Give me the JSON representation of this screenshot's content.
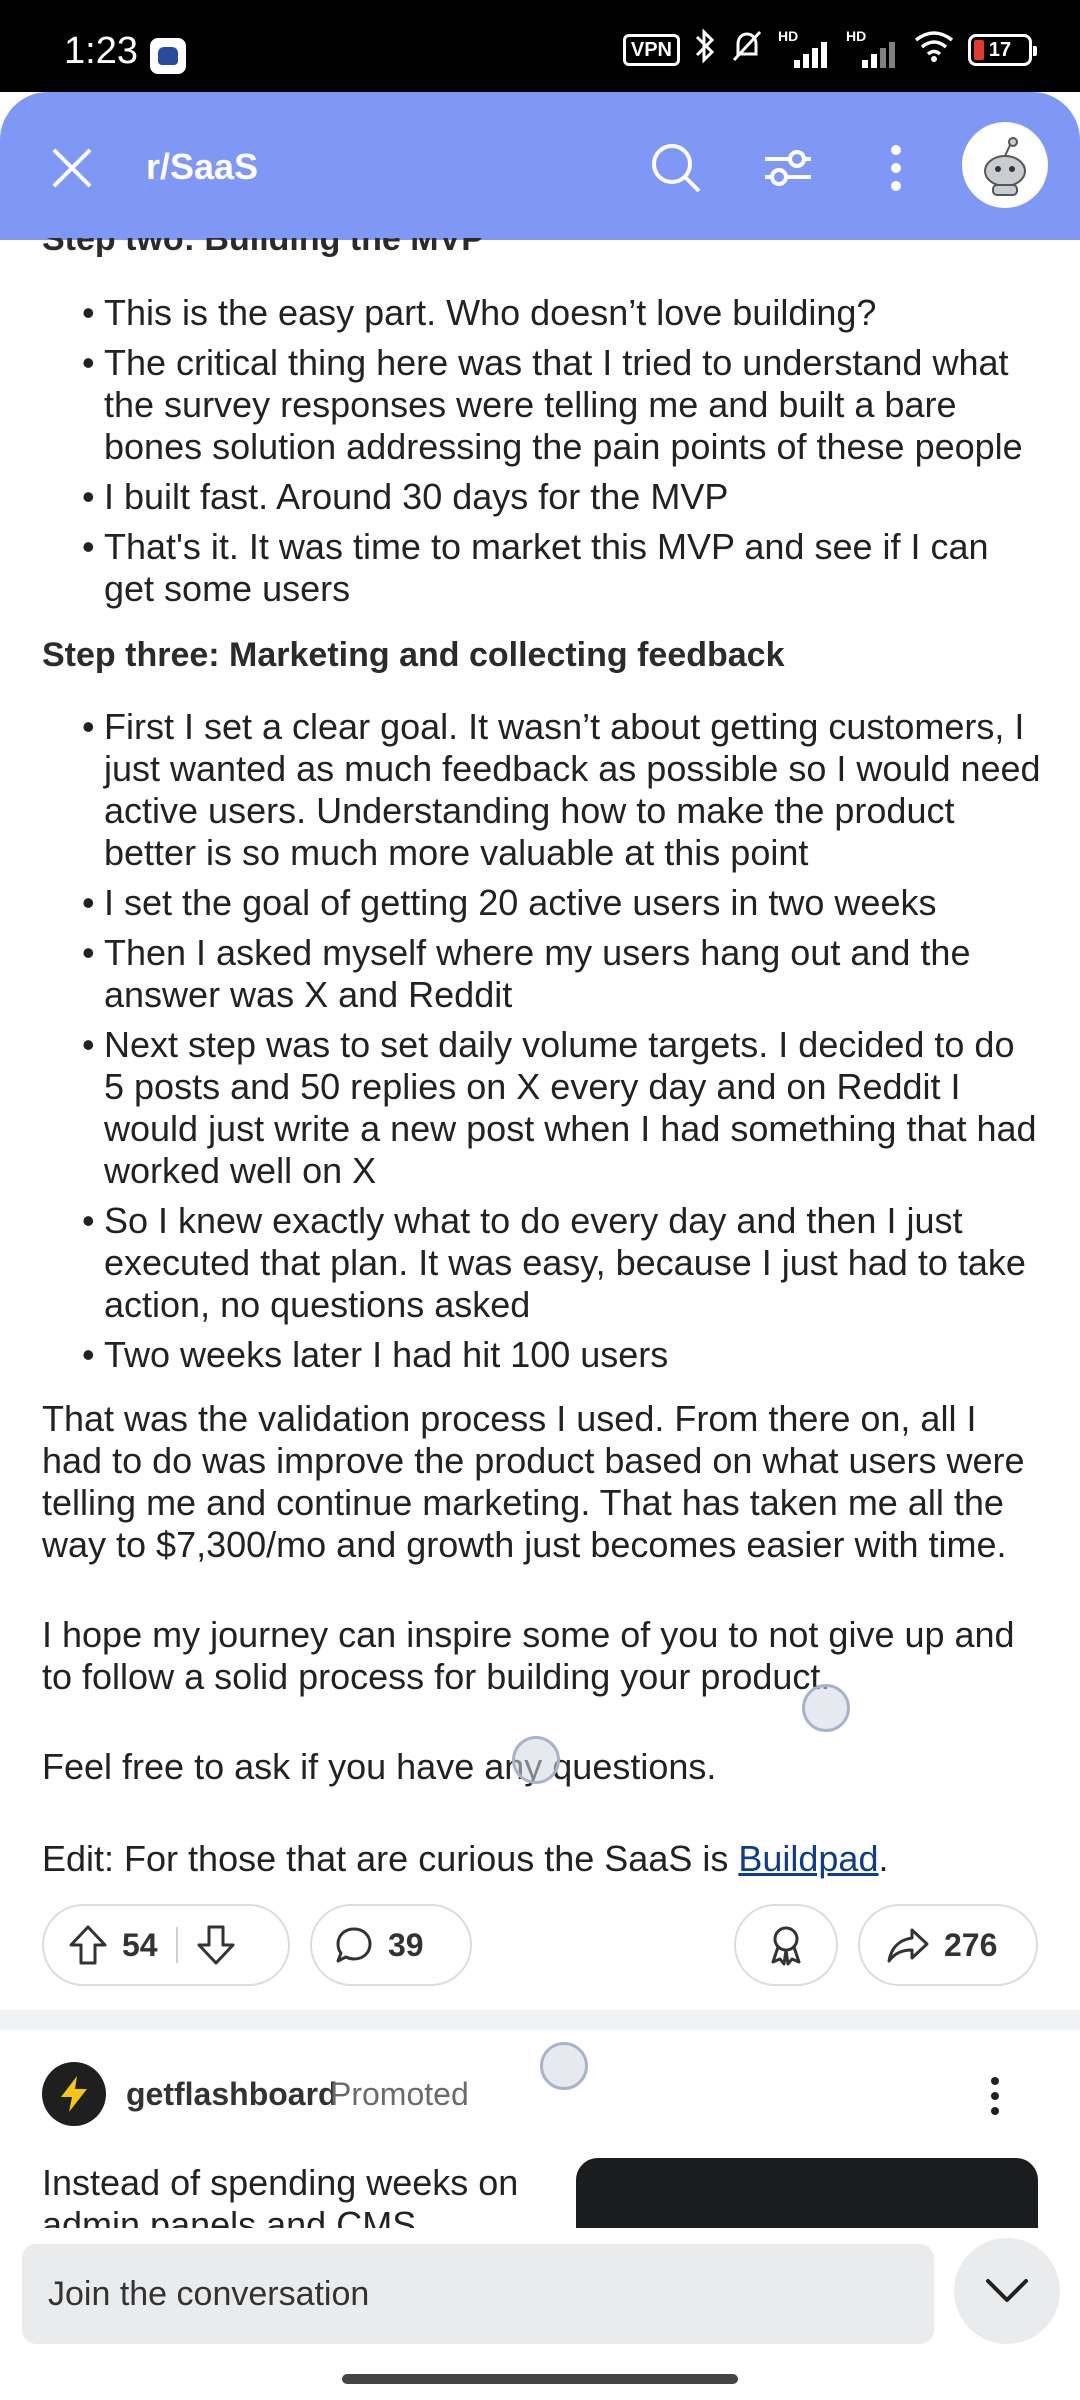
{
  "status_bar": {
    "time": "1:23",
    "vpn_label": "VPN",
    "hd_label_1": "HD",
    "hd_label_2": "HD",
    "battery_level": "17"
  },
  "header": {
    "subreddit": "r/SaaS",
    "icons": [
      "close-icon",
      "search-icon",
      "filter-icon",
      "more-vertical-icon",
      "avatar"
    ]
  },
  "post": {
    "step_two_heading": "Step two: Building the MVP",
    "step_two_bullets": [
      "This is the easy part. Who doesn’t love building?",
      "The critical thing here was that I tried to understand what the survey responses were telling me and built a bare bones solution addressing the pain points of these people",
      "I built fast. Around 30 days for the MVP",
      "That's it. It was time to market this MVP and see if I can get some users"
    ],
    "step_three_heading": "Step three: Marketing and collecting feedback",
    "step_three_bullets": [
      "First I set a clear goal. It wasn’t about getting customers, I just wanted as much feedback as possible so I would need active users. Understanding how to make the product better is so much more valuable at this point",
      "I set the goal of getting 20 active users in two weeks",
      "Then I asked myself where my users hang out and the answer was X and Reddit",
      "Next step was to set daily volume targets. I decided to do 5 posts and 50 replies on X every day and on Reddit I would just write a new post when I had something that had worked well on X",
      "So I knew exactly what to do every day and then I just executed that plan. It was easy, because I just had to take action, no questions asked",
      "Two weeks later I had hit 100 users"
    ],
    "para_validation": "That was the validation process I used. From there on, all I had to do was improve the product based on what users were telling me and continue marketing. That has taken me all the way to $7,300/mo and growth just becomes easier with time.",
    "para_hope": "I hope my journey can inspire some of you to not give up and to follow a solid process for building your product.",
    "para_questions": "Feel free to ask if you have any questions.",
    "edit_prefix": "Edit: For those that are curious the SaaS is ",
    "edit_link": "Buildpad",
    "edit_suffix": "."
  },
  "actions": {
    "upvotes": "54",
    "comments": "39",
    "shares": "276"
  },
  "promoted": {
    "name": "getflashboard",
    "tag": "Promoted",
    "text": "Instead of spending weeks on admin panels and CMS"
  },
  "composer": {
    "placeholder": "Join the conversation"
  },
  "colors": {
    "header_bg": "#7f97f5",
    "link": "#0d3c88"
  }
}
